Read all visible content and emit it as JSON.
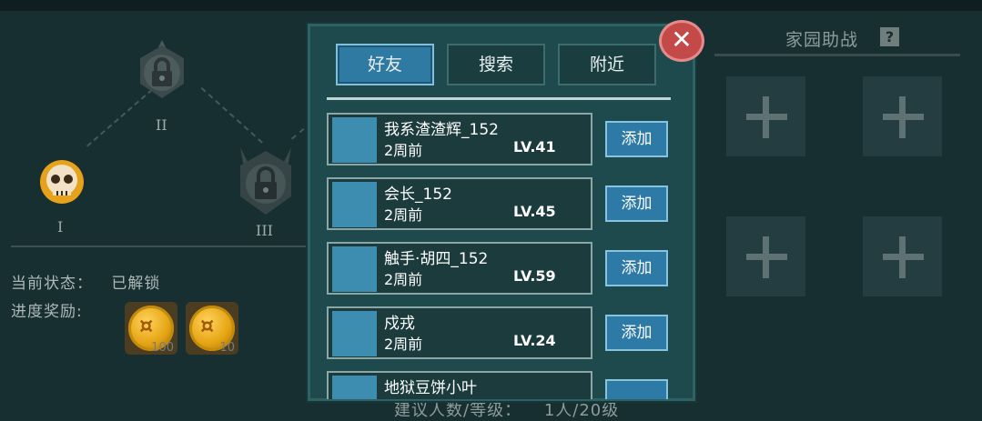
{
  "progress": {
    "nodes": [
      {
        "label": "I",
        "icon": "skull-icon",
        "state": "unlocked"
      },
      {
        "label": "II",
        "icon": "lock-icon",
        "state": "locked"
      },
      {
        "label": "III",
        "icon": "lock-icon",
        "state": "locked"
      }
    ],
    "status_label": "当前状态：",
    "status_value": "已解锁",
    "reward_label": "进度奖励:",
    "rewards": [
      {
        "icon": "gold-coin-icon",
        "qty": "100"
      },
      {
        "icon": "gold-coin-icon",
        "qty": "10"
      }
    ]
  },
  "home_support": {
    "title": "家园助战",
    "help": "?",
    "slots": 4
  },
  "modal": {
    "tabs": [
      {
        "label": "好友",
        "active": true
      },
      {
        "label": "搜索",
        "active": false
      },
      {
        "label": "附近",
        "active": false
      }
    ],
    "close_icon": "close-icon",
    "rows": [
      {
        "name": "我系渣渣辉_152",
        "time": "2周前",
        "level": "LV.41",
        "action": "添加"
      },
      {
        "name": "会长_152",
        "time": "2周前",
        "level": "LV.45",
        "action": "添加"
      },
      {
        "name": "触手·胡四_152",
        "time": "2周前",
        "level": "LV.59",
        "action": "添加"
      },
      {
        "name": "戍戎",
        "time": "2周前",
        "level": "LV.24",
        "action": "添加"
      },
      {
        "name": "地狱豆饼小叶",
        "time": "",
        "level": "",
        "action": ""
      }
    ]
  },
  "footer": {
    "suggest_label": "建议人数/等级：",
    "suggest_value": "1人/20级"
  },
  "colors": {
    "background": "#182f31",
    "modal_bg": "#1f4a4d",
    "accent_blue": "#2f7aa2",
    "close_red": "#c44a4a",
    "coin_gold": "#e5a414"
  }
}
